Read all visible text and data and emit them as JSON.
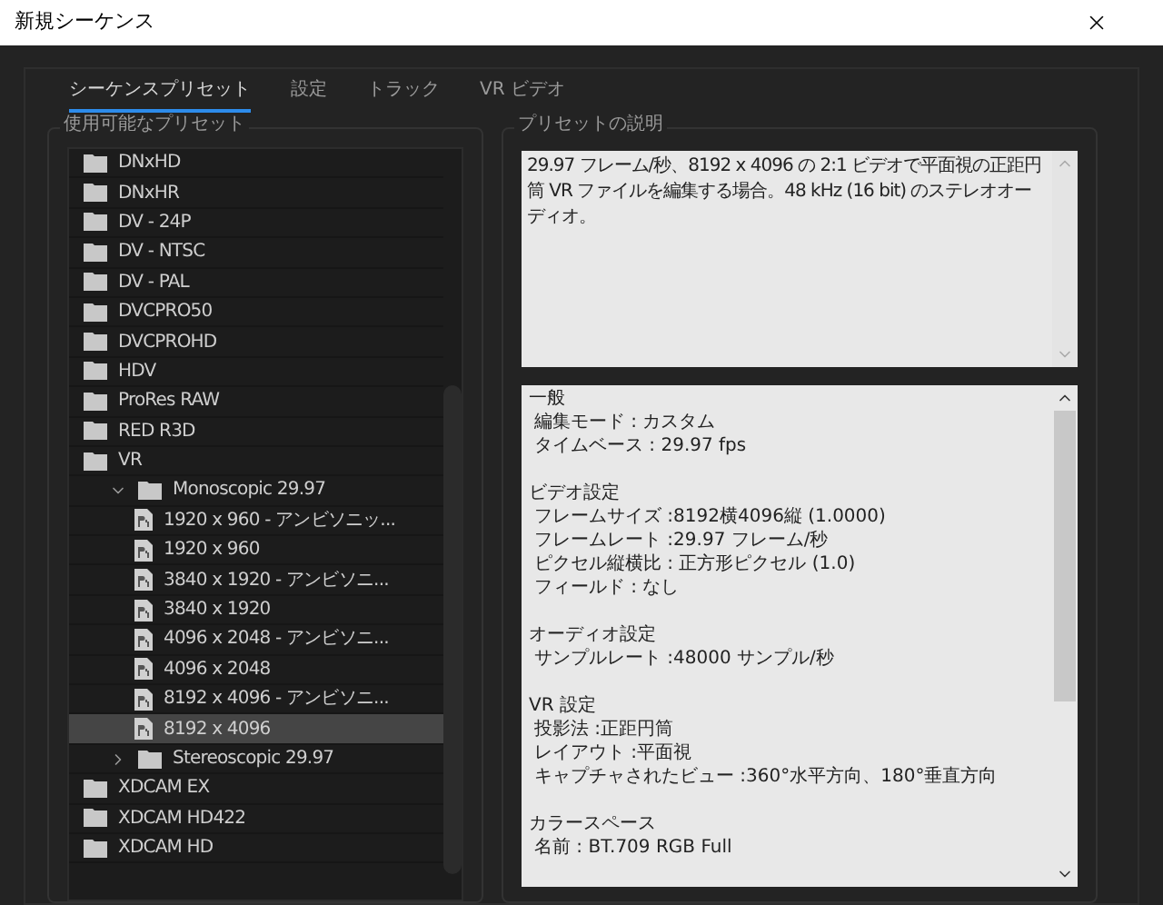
{
  "window": {
    "title": "新規シーケンス"
  },
  "tabs": [
    {
      "label": "シーケンスプリセット",
      "selected": true
    },
    {
      "label": "設定",
      "selected": false
    },
    {
      "label": "トラック",
      "selected": false
    },
    {
      "label": "VR ビデオ",
      "selected": false
    }
  ],
  "presets_panel": {
    "title": "使用可能なプリセット",
    "items": [
      {
        "kind": "folder",
        "label": "DNxHD",
        "selected": false
      },
      {
        "kind": "folder",
        "label": "DNxHR",
        "selected": false
      },
      {
        "kind": "folder",
        "label": "DV - 24P",
        "selected": false
      },
      {
        "kind": "folder",
        "label": "DV - NTSC",
        "selected": false
      },
      {
        "kind": "folder",
        "label": "DV - PAL",
        "selected": false
      },
      {
        "kind": "folder",
        "label": "DVCPRO50",
        "selected": false
      },
      {
        "kind": "folder",
        "label": "DVCPROHD",
        "selected": false
      },
      {
        "kind": "folder",
        "label": "HDV",
        "selected": false
      },
      {
        "kind": "folder",
        "label": "ProRes RAW",
        "selected": false
      },
      {
        "kind": "folder",
        "label": "RED R3D",
        "selected": false
      },
      {
        "kind": "folder",
        "label": "VR",
        "selected": false,
        "children": [
          {
            "kind": "folder",
            "label": "Monoscopic 29.97",
            "selected": false,
            "expanded": true,
            "children": [
              {
                "kind": "preset",
                "label": "1920 x 960 - アンビソニッ...",
                "selected": false
              },
              {
                "kind": "preset",
                "label": "1920 x 960",
                "selected": false
              },
              {
                "kind": "preset",
                "label": "3840 x 1920 - アンビソニ...",
                "selected": false
              },
              {
                "kind": "preset",
                "label": "3840 x 1920",
                "selected": false
              },
              {
                "kind": "preset",
                "label": "4096 x 2048 - アンビソニ...",
                "selected": false
              },
              {
                "kind": "preset",
                "label": "4096 x 2048",
                "selected": false
              },
              {
                "kind": "preset",
                "label": "8192 x 4096 - アンビソニ...",
                "selected": false
              },
              {
                "kind": "preset",
                "label": "8192 x 4096",
                "selected": true
              }
            ]
          },
          {
            "kind": "folder",
            "label": "Stereoscopic 29.97",
            "selected": false,
            "expanded": false
          }
        ]
      },
      {
        "kind": "folder",
        "label": "XDCAM EX",
        "selected": false
      },
      {
        "kind": "folder",
        "label": "XDCAM HD422",
        "selected": false
      },
      {
        "kind": "folder",
        "label": "XDCAM HD",
        "selected": false
      }
    ]
  },
  "description_panel": {
    "title": "プリセットの説明",
    "description": "29.97 フレーム/秒、8192 x 4096 の 2:1 ビデオで平面視の正距円筒 VR ファイルを編集する場合。48 kHz (16 bit) のステレオオーディオ。",
    "settings": [
      {
        "heading": "一般",
        "lines": [
          "編集モード : カスタム",
          "タイムベース : 29.97 fps"
        ]
      },
      {
        "heading": "ビデオ設定",
        "lines": [
          "フレームサイズ :8192横4096縦 (1.0000)",
          "フレームレート :29.97  フレーム/秒",
          "ピクセル縦横比 : 正方形ピクセル (1.0)",
          "フィールド : なし"
        ]
      },
      {
        "heading": "オーディオ設定",
        "lines": [
          "サンプルレート :48000 サンプル/秒"
        ]
      },
      {
        "heading": "VR 設定",
        "lines": [
          "投影法 :正距円筒",
          "レイアウト :平面視",
          "キャプチャされたビュー :360°水平方向、180°垂直方向"
        ]
      },
      {
        "heading": "カラースペース",
        "lines": [
          "名前 : BT.709 RGB Full"
        ]
      }
    ]
  }
}
